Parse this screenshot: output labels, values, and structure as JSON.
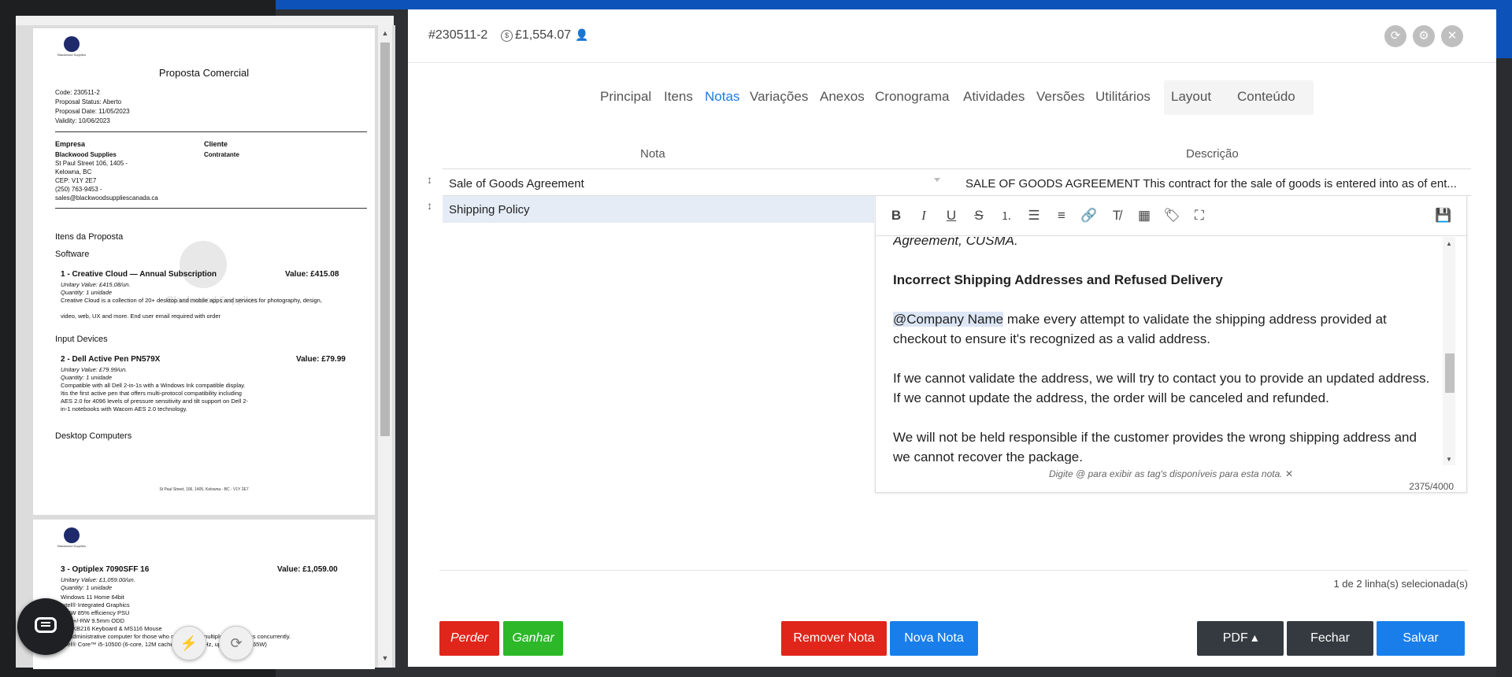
{
  "preview": {
    "page1": {
      "logo_text": "Blackwood Supplies",
      "title": "Proposta Comercial",
      "code": "Code:  230511-2",
      "status": "Proposal Status:  Aberto",
      "date": "Proposal Date:  11/05/2023",
      "validity": "Validity:  10/06/2023",
      "empresa_label": "Empresa",
      "cliente_label": "Cliente",
      "company_name": "Blackwood Supplies",
      "address1": "St Paul Street 106, 1405 -",
      "address2": "Kelowna, BC",
      "cep": "CEP: V1Y 2E7",
      "phone": "(250) 763-9453 -",
      "email": "sales@blackwoodsuppliescanada.ca",
      "contratante": "Contratante",
      "items_title": "Itens da Proposta",
      "watermark": "Blackwood Supplies",
      "cat1": "Software",
      "item1_title": "1 - Creative Cloud — Annual Subscription",
      "item1_value": "Value: £415.08",
      "item1_unit": "Unitary Value: £415.08/un.",
      "item1_qty": "Quantity: 1 unidade",
      "item1_desc1": "Creative Cloud is a collection of 20+ desktop and mobile apps and services for photography, design,",
      "item1_desc2": "video, web, UX and more. End user email required with order",
      "cat2": "Input Devices",
      "item2_title": "2 - Dell Active Pen PN579X",
      "item2_value": "Value: £79.99",
      "item2_unit": "Unitary Value: £79.99/un.",
      "item2_qty": "Quantity: 1 unidade",
      "item2_desc1": "Compatible with all Dell 2-in-1s with a Windows Ink compatible display.",
      "item2_desc2": "Itis the first active pen that offers multi-protocol compatibility including",
      "item2_desc3": "AES 2.0 for 4096 levels of pressure sensitivity and tilt support on Dell 2-",
      "item2_desc4": "in-1 notebooks with Wacom AES 2.0 technology.",
      "cat3": "Desktop Computers",
      "footer": "St Paul Street, 106, 1405, Kelowna - BC - V1Y 2E7"
    },
    "page2": {
      "item3_title": "3 - Optiplex 7090SFF 16",
      "item3_value": "Value: £1,059.00",
      "item3_unit": "Unitary Value: £1,059.00/un.",
      "item3_qty": "Quantity: 1 unidade",
      "item3_l1": "Windows 11 Home 64bit",
      "item3_l2": "Intel® Integrated Graphics",
      "item3_l3": "260W 85% efficiency PSU",
      "item3_l4": "DVD+/-RW 9.5mm ODD",
      "item3_l5": "Dell KB216 Keyboard & MS116 Mouse",
      "item3_l6": "An administrative computer for those who need to run multiple applications concurrently.",
      "item3_l7": "Intel® Core™ i5-10500 (6-core, 12M cache, base 3.1GHz, up to 4.5GHz, 65W)"
    }
  },
  "header": {
    "code": "#230511-2",
    "amount": "£1,554.07"
  },
  "tabs": [
    "Principal",
    "Itens",
    "Notas",
    "Variações",
    "Anexos",
    "Cronograma",
    "Atividades",
    "Versões",
    "Utilitários",
    "Layout",
    "Conteúdo"
  ],
  "grid": {
    "col_note": "Nota",
    "col_desc": "Descrição",
    "rows": [
      {
        "note": "Sale of Goods Agreement",
        "desc": "SALE OF GOODS AGREEMENT This contract for the sale of goods is entered into as of ent..."
      },
      {
        "note": "Shipping Policy",
        "desc": ""
      }
    ]
  },
  "editor": {
    "line0": "Agreement, CUSMA.",
    "heading": "Incorrect Shipping Addresses and Refused Delivery",
    "tag": "@Company Name",
    "p1": " make every attempt to validate the shipping address provided at checkout to ensure it's recognized as a valid address.",
    "p2": "If we cannot validate the address, we will try to contact you to provide an updated address. If we cannot update the address, the order will be canceled and refunded.",
    "p3": "We will not be held responsible if the customer provides the wrong shipping address and we cannot recover the package.",
    "hint": "Digite @ para exibir as tag's disponíveis para esta nota.",
    "counter": "2375/4000"
  },
  "status_text": "1 de 2 linha(s) selecionada(s)",
  "buttons": {
    "perder": "Perder",
    "ganhar": "Ganhar",
    "remover": "Remover Nota",
    "nova": "Nova Nota",
    "pdf": "PDF ▴",
    "fechar": "Fechar",
    "salvar": "Salvar"
  },
  "colors": {
    "accent": "#1a7eea",
    "danger": "#e0261b",
    "success": "#2db829",
    "dark": "#343a40"
  }
}
